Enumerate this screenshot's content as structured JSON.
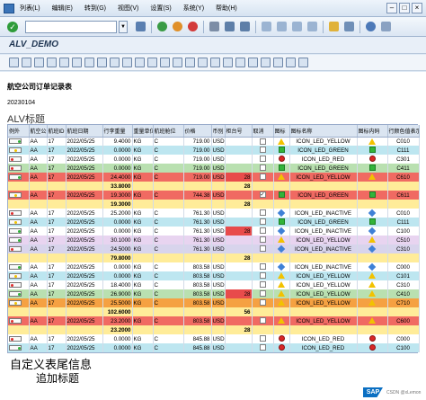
{
  "menubar": {
    "items": [
      "列表(L)",
      "编辑(E)",
      "转到(G)",
      "视图(V)",
      "设置(S)",
      "系统(Y)",
      "帮助(H)"
    ]
  },
  "toolbar": {
    "command_placeholder": ""
  },
  "app": {
    "title": "ALV_DEMO"
  },
  "report": {
    "title": "航空公司订单记录表",
    "date": "20230104",
    "alv_title": "ALV标题"
  },
  "columns": [
    "例外",
    "航空公司",
    "航班ID",
    "航班日期",
    "行李重量",
    "重量单位",
    "航班舱位",
    "价格",
    "币别",
    "柜台号",
    "取消",
    "图标",
    "图标名称",
    "图标内码",
    "行颜色值表示"
  ],
  "rows": [
    {
      "bg": "#fff",
      "light": "g",
      "c": [
        "AA",
        "17",
        "2022/05/25",
        "9.4000",
        "KG",
        "C",
        "719.00",
        "USD",
        "",
        "",
        "tri",
        "ICON_LED_YELLOW",
        "C010"
      ]
    },
    {
      "bg": "#bde6f0",
      "light": "y",
      "c": [
        "AA",
        "17",
        "2022/05/25",
        "0.0000",
        "KG",
        "C",
        "719.00",
        "USD",
        "",
        "",
        "sq",
        "ICON_LED_GREEN",
        "C111"
      ]
    },
    {
      "bg": "#fff",
      "light": "r",
      "c": [
        "AA",
        "17",
        "2022/05/25",
        "0.0000",
        "KG",
        "C",
        "719.00",
        "USD",
        "",
        "",
        "circ",
        "ICON_LED_RED",
        "C301"
      ]
    },
    {
      "bg": "#b9e0b0",
      "light": "r",
      "c": [
        "AA",
        "17",
        "2022/05/25",
        "0.0000",
        "KG",
        "C",
        "719.00",
        "USD",
        "",
        "",
        "sq",
        "ICON_LED_GREEN",
        "C411"
      ]
    },
    {
      "bg": "#f06a62",
      "light": "g",
      "c": [
        "AA",
        "17",
        "2022/05/25",
        "24.4000",
        "KG",
        "C",
        "719.00",
        "USD",
        "28",
        "",
        "tri",
        "ICON_LED_YELLOW",
        "C610"
      ]
    },
    {
      "bg": "#ffec99",
      "sum": true,
      "c": [
        "",
        "",
        "",
        "33.8000",
        "",
        "",
        "",
        "",
        "28",
        "",
        "",
        "",
        ""
      ]
    },
    {
      "bg": "#f06a62",
      "light": "y",
      "c": [
        "AA",
        "17",
        "2022/05/25",
        "19.3000",
        "KG",
        "C",
        "744.38",
        "USD",
        "",
        "chk",
        "sq",
        "ICON_LED_GREEN",
        "C611"
      ]
    },
    {
      "bg": "#ffec99",
      "sum": true,
      "c": [
        "",
        "",
        "",
        "19.3000",
        "",
        "",
        "",
        "",
        "28",
        "",
        "",
        "",
        ""
      ]
    },
    {
      "bg": "#fff",
      "light": "r",
      "c": [
        "AA",
        "17",
        "2022/05/25",
        "25.2000",
        "KG",
        "C",
        "761.30",
        "USD",
        "",
        "",
        "dia",
        "ICON_LED_INACTIVE",
        "C010"
      ]
    },
    {
      "bg": "#bde6f0",
      "light": "y",
      "c": [
        "AA",
        "17",
        "2022/05/25",
        "0.0000",
        "KG",
        "C",
        "761.30",
        "USD",
        "",
        "",
        "sq",
        "ICON_LED_GREEN",
        "C111"
      ]
    },
    {
      "bg": "#fff",
      "light": "g",
      "c": [
        "AA",
        "17",
        "2022/05/25",
        "0.0000",
        "KG",
        "C",
        "761.30",
        "USD",
        "28",
        "",
        "dia",
        "ICON_LED_INACTIVE",
        "C100"
      ]
    },
    {
      "bg": "#e8d4f0",
      "light": "g",
      "c": [
        "AA",
        "17",
        "2022/05/25",
        "30.1000",
        "KG",
        "C",
        "761.30",
        "USD",
        "",
        "",
        "tri",
        "ICON_LED_YELLOW",
        "C510"
      ]
    },
    {
      "bg": "#d8d4ec",
      "light": "r",
      "c": [
        "AA",
        "17",
        "2022/05/25",
        "24.5000",
        "KG",
        "C",
        "761.30",
        "USD",
        "",
        "",
        "dia",
        "ICON_LED_INACTIVE",
        "C310"
      ]
    },
    {
      "bg": "#ffec99",
      "sum": true,
      "c": [
        "",
        "",
        "",
        "79.8000",
        "",
        "",
        "",
        "",
        "28",
        "",
        "",
        "",
        ""
      ]
    },
    {
      "bg": "#fff",
      "light": "g",
      "c": [
        "AA",
        "17",
        "2022/05/25",
        "0.0000",
        "KG",
        "C",
        "803.58",
        "USD",
        "",
        "",
        "dia",
        "ICON_LED_INACTIVE",
        "C000"
      ]
    },
    {
      "bg": "#bde6f0",
      "light": "y",
      "c": [
        "AA",
        "17",
        "2022/05/25",
        "0.0000",
        "KG",
        "C",
        "803.58",
        "USD",
        "",
        "",
        "tri",
        "ICON_LED_YELLOW",
        "C101"
      ]
    },
    {
      "bg": "#fff",
      "light": "r",
      "c": [
        "AA",
        "17",
        "2022/05/25",
        "18.4000",
        "KG",
        "C",
        "803.58",
        "USD",
        "",
        "",
        "tri",
        "ICON_LED_YELLOW",
        "C310"
      ]
    },
    {
      "bg": "#b9e0b0",
      "light": "g",
      "c": [
        "AA",
        "17",
        "2022/05/25",
        "26.9000",
        "KG",
        "C",
        "803.58",
        "USD",
        "28",
        "",
        "tri",
        "ICON_LED_YELLOW",
        "C410"
      ]
    },
    {
      "bg": "#f5a142",
      "light": "y",
      "c": [
        "AA",
        "17",
        "2022/05/25",
        "25.5000",
        "KG",
        "C",
        "803.58",
        "USD",
        "",
        "",
        "tri",
        "ICON_LED_YELLOW",
        "C710"
      ]
    },
    {
      "bg": "#ffec99",
      "sum": true,
      "c": [
        "",
        "",
        "",
        "102.6000",
        "",
        "",
        "",
        "",
        "56",
        "",
        "",
        "",
        ""
      ]
    },
    {
      "bg": "#f06a62",
      "light": "r",
      "c": [
        "AA",
        "17",
        "2022/05/25",
        "23.2000",
        "KG",
        "C",
        "803.58",
        "USD",
        "",
        "",
        "tri",
        "ICON_LED_YELLOW",
        "C600"
      ]
    },
    {
      "bg": "#ffec99",
      "sum": true,
      "c": [
        "",
        "",
        "",
        "23.2000",
        "",
        "",
        "",
        "",
        "28",
        "",
        "",
        "",
        ""
      ]
    },
    {
      "bg": "#fff",
      "light": "r",
      "c": [
        "AA",
        "17",
        "2022/05/25",
        "0.0000",
        "KG",
        "C",
        "845.88",
        "USD",
        "",
        "",
        "circ",
        "ICON_LED_RED",
        "C000"
      ]
    },
    {
      "bg": "#bde6f0",
      "light": "g",
      "c": [
        "AA",
        "17",
        "2022/05/25",
        "0.0000",
        "KG",
        "C",
        "845.88",
        "USD",
        "",
        "",
        "circ",
        "ICON_LED_RED",
        "C100"
      ]
    }
  ],
  "footer": {
    "main": "自定义表尾信息",
    "sub": "追加标题"
  },
  "sap_logo": "SAP",
  "credit": "CSDN @xLemon"
}
